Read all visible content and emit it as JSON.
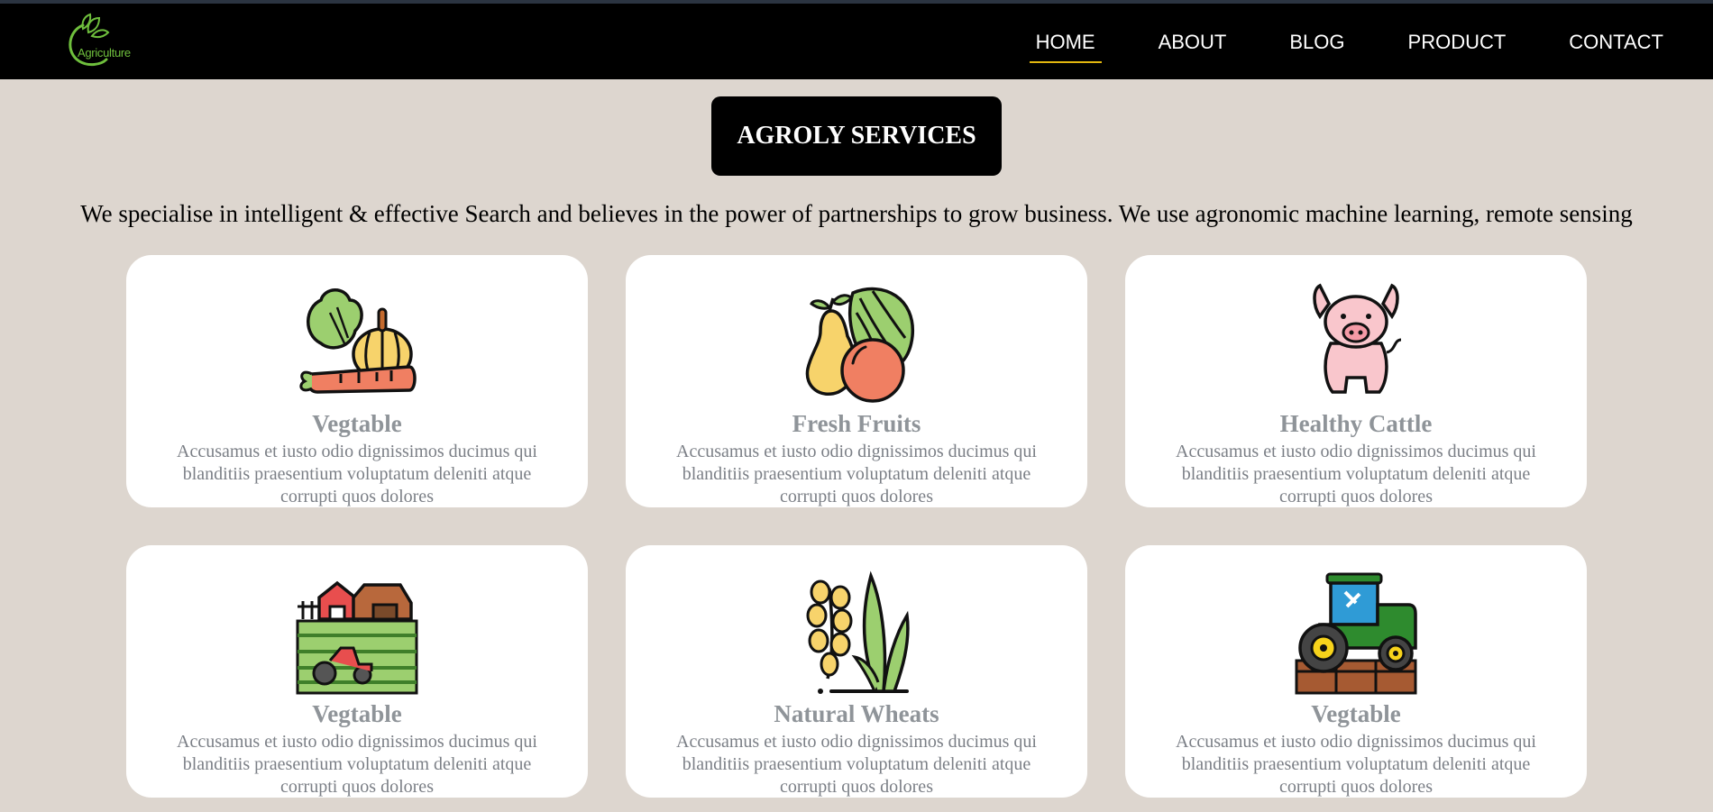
{
  "header": {
    "logo_text": "Agriculture",
    "nav": [
      {
        "label": "HOME",
        "active": true
      },
      {
        "label": "ABOUT",
        "active": false
      },
      {
        "label": "BLOG",
        "active": false
      },
      {
        "label": "PRODUCT",
        "active": false
      },
      {
        "label": "CONTACT",
        "active": false
      }
    ]
  },
  "main": {
    "title": "AGROLY SERVICES",
    "intro": "We specialise in intelligent & effective Search and believes in the power of partnerships to grow business. We use agronomic machine learning, remote sensing",
    "cards": [
      {
        "icon": "vegetables-icon",
        "title": "Vegtable",
        "description": "Accusamus et iusto odio dignissimos ducimus qui blanditiis praesentium voluptatum deleniti atque corrupti quos dolores"
      },
      {
        "icon": "fruits-icon",
        "title": "Fresh Fruits",
        "description": "Accusamus et iusto odio dignissimos ducimus qui blanditiis praesentium voluptatum deleniti atque corrupti quos dolores"
      },
      {
        "icon": "pig-icon",
        "title": "Healthy Cattle",
        "description": "Accusamus et iusto odio dignissimos ducimus qui blanditiis praesentium voluptatum deleniti atque corrupti quos dolores"
      },
      {
        "icon": "farm-icon",
        "title": "Vegtable",
        "description": "Accusamus et iusto odio dignissimos ducimus qui blanditiis praesentium voluptatum deleniti atque corrupti quos dolores"
      },
      {
        "icon": "wheat-icon",
        "title": "Natural Wheats",
        "description": "Accusamus et iusto odio dignissimos ducimus qui blanditiis praesentium voluptatum deleniti atque corrupti quos dolores"
      },
      {
        "icon": "tractor-icon",
        "title": "Vegtable",
        "description": "Accusamus et iusto odio dignissimos ducimus qui blanditiis praesentium voluptatum deleniti atque corrupti quos dolores"
      }
    ]
  },
  "colors": {
    "background": "#ddd6cf",
    "navbar": "#000000",
    "active_underline": "#e3b70f",
    "logo_green": "#6fbf3d",
    "card_title": "#8f9499",
    "card_text": "#7b7f86"
  }
}
